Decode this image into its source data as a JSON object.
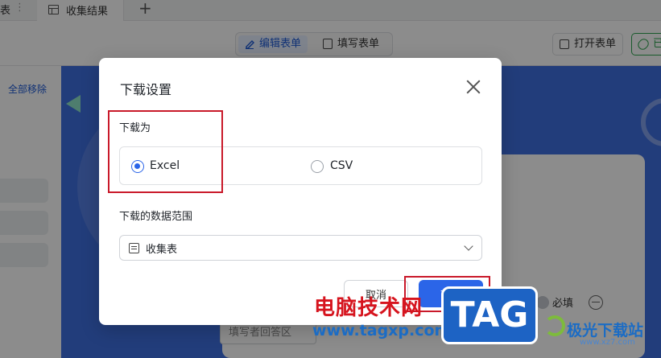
{
  "tabs": {
    "partial_label": "表",
    "active_label": "收集结果",
    "add_label": "+"
  },
  "toolbar": {
    "edit_label": "编辑表单",
    "fill_label": "填写表单",
    "open_label": "打开表单",
    "share_label": "已"
  },
  "left_panel": {
    "remove_all": "全部移除"
  },
  "form_preview": {
    "required_label": "必填",
    "answer_placeholder": "填写者回答区"
  },
  "dialog": {
    "title": "下载设置",
    "format_label": "下载为",
    "formats": [
      {
        "label": "Excel",
        "selected": true
      },
      {
        "label": "CSV",
        "selected": false
      }
    ],
    "range_label": "下载的数据范围",
    "range_value": "收集表",
    "cancel_label": "取消",
    "download_label": "下载"
  },
  "watermark": {
    "cn": "电脑技术网",
    "url": "www.tagxp.com",
    "badge": "TAG",
    "site": "极光下载站",
    "site_url": "www.xz7.com"
  },
  "colors": {
    "accent": "#2b65e8",
    "highlight": "#c9192a",
    "banner": "#3f6fe0"
  },
  "icons": [
    "close-icon",
    "pen-icon",
    "document-icon",
    "table-icon",
    "chevron-down-icon",
    "link-icon",
    "external-icon",
    "minus-circle-icon"
  ]
}
